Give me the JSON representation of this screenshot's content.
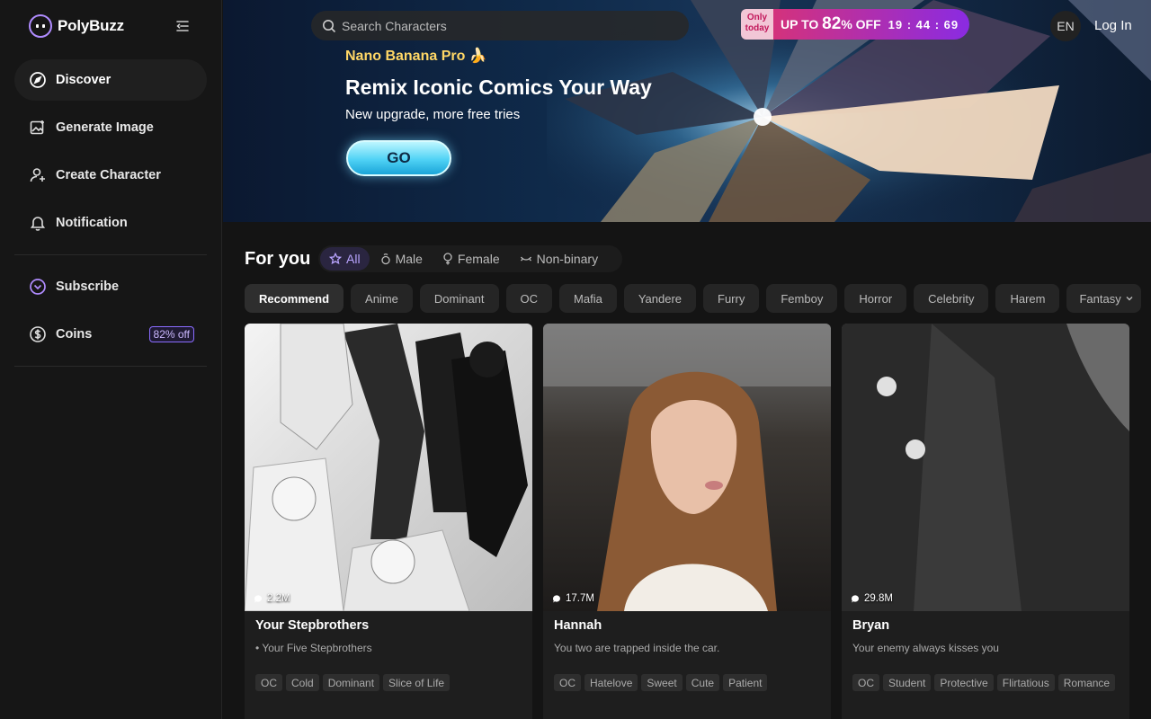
{
  "app": {
    "name": "PolyBuzz"
  },
  "sidebar": {
    "items": [
      {
        "label": "Discover",
        "icon": "compass-icon",
        "active": true
      },
      {
        "label": "Generate Image",
        "icon": "image-plus-icon"
      },
      {
        "label": "Create Character",
        "icon": "user-plus-icon"
      },
      {
        "label": "Notification",
        "icon": "bell-icon"
      }
    ],
    "subscribe_label": "Subscribe",
    "coins_label": "Coins",
    "coins_badge": "82% off"
  },
  "header": {
    "search_placeholder": "Search Characters",
    "promo_only": "Only today",
    "promo_prefix": "UP TO",
    "promo_percent": "82",
    "promo_suffix": "% OFF",
    "timer": "19 : 44 : 69",
    "lang": "EN",
    "login_label": "Log In"
  },
  "banner": {
    "subtitle": "Nano Banana Pro 🍌",
    "title": "Remix Iconic Comics Your Way",
    "description": "New upgrade, more free tries",
    "button_label": "GO"
  },
  "section": {
    "title": "For you",
    "gender_tabs": [
      {
        "label": "All",
        "icon": "star-icon",
        "active": true
      },
      {
        "label": "Male",
        "icon": "male-icon"
      },
      {
        "label": "Female",
        "icon": "female-icon"
      },
      {
        "label": "Non-binary",
        "icon": "nonbinary-icon"
      }
    ],
    "categories": [
      "Recommend",
      "Anime",
      "Dominant",
      "OC",
      "Mafia",
      "Yandere",
      "Furry",
      "Femboy",
      "Horror",
      "Celebrity",
      "Harem",
      "Fantasy"
    ]
  },
  "cards": [
    {
      "name": "Your Stepbrothers",
      "desc": "• Your Five Stepbrothers",
      "count": "2.2M",
      "tags": [
        "OC",
        "Cold",
        "Dominant",
        "Slice of Life"
      ]
    },
    {
      "name": "Hannah",
      "desc": "You two are trapped inside the car.",
      "count": "17.7M",
      "tags": [
        "OC",
        "Hatelove",
        "Sweet",
        "Cute",
        "Patient"
      ]
    },
    {
      "name": "Bryan",
      "desc": "Your enemy always kisses you",
      "count": "29.8M",
      "tags": [
        "OC",
        "Student",
        "Protective",
        "Flirtatious",
        "Romance"
      ]
    }
  ],
  "colors": {
    "accent": "#8a6cff",
    "background": "#141414",
    "go_button": "#4fd2f5",
    "promo": "#e0336b"
  }
}
